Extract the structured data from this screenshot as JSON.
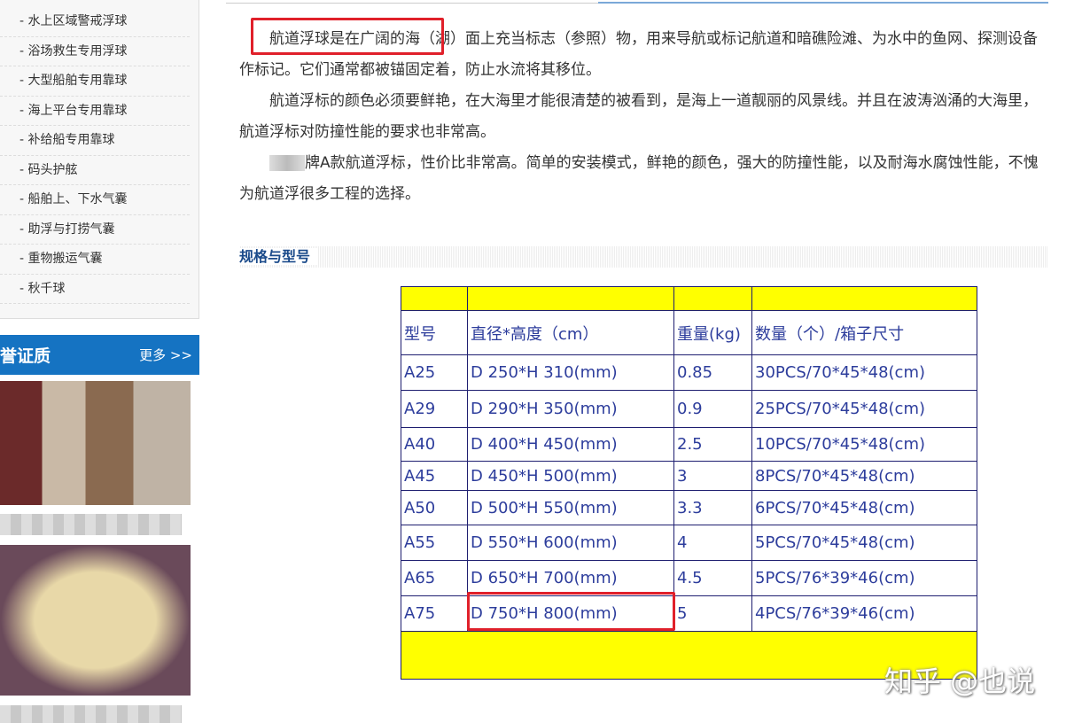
{
  "sidebar": {
    "items": [
      "- 水上区域警戒浮球",
      "- 浴场救生专用浮球",
      "- 大型船舶专用靠球",
      "- 海上平台专用靠球",
      "- 补给船专用靠球",
      "- 码头护舷",
      "- 船舶上、下水气囊",
      "- 助浮与打捞气囊",
      "- 重物搬运气囊",
      "- 秋千球"
    ]
  },
  "honor": {
    "title": "誉证质",
    "more": "更多 >>"
  },
  "intro": {
    "p1": "航道浮球是在广阔的海（湖）面上充当标志（参照）物，用来导航或标记航道和暗礁险滩、为水中的鱼网、探测设备作标记。它们通常都被锚固定着，防止水流将其移位。",
    "p2": "航道浮标的颜色必须要鲜艳，在大海里才能很清楚的被看到，是海上一道靓丽的风景线。并且在波涛汹涌的大海里，航道浮标对防撞性能的要求也非常高。",
    "p3": "牌A款航道浮标，性价比非常高。简单的安装模式，鲜艳的颜色，强大的防撞性能，以及耐海水腐蚀性能，不愧为航道浮很多工程的选择。"
  },
  "spec": {
    "title": "规格与型号"
  },
  "table": {
    "headers": [
      "型号",
      "直径*高度（cm）",
      "重量(kg)",
      "数量（个）/箱子尺寸"
    ],
    "rows": [
      [
        "A25",
        "D 250*H 310(mm)",
        "0.85",
        "30PCS/70*45*48(cm)"
      ],
      [
        "A29",
        "D 290*H 350(mm)",
        "0.9",
        "25PCS/70*45*48(cm)"
      ],
      [
        "A40",
        "D 400*H 450(mm)",
        "2.5",
        "10PCS/70*45*48(cm)"
      ],
      [
        "A45",
        "D 450*H 500(mm)",
        "3",
        "8PCS/70*45*48(cm)"
      ],
      [
        "A50",
        "D 500*H 550(mm)",
        "3.3",
        "6PCS/70*45*48(cm)"
      ],
      [
        "A55",
        "D 550*H 600(mm)",
        "4",
        "5PCS/70*45*48(cm)"
      ],
      [
        "A65",
        "D 650*H 700(mm)",
        "4.5",
        "5PCS/76*39*46(cm)"
      ],
      [
        "A75",
        "D 750*H 800(mm)",
        "5",
        "4PCS/76*39*46(cm)"
      ]
    ]
  },
  "watermark": "知乎 @也说"
}
